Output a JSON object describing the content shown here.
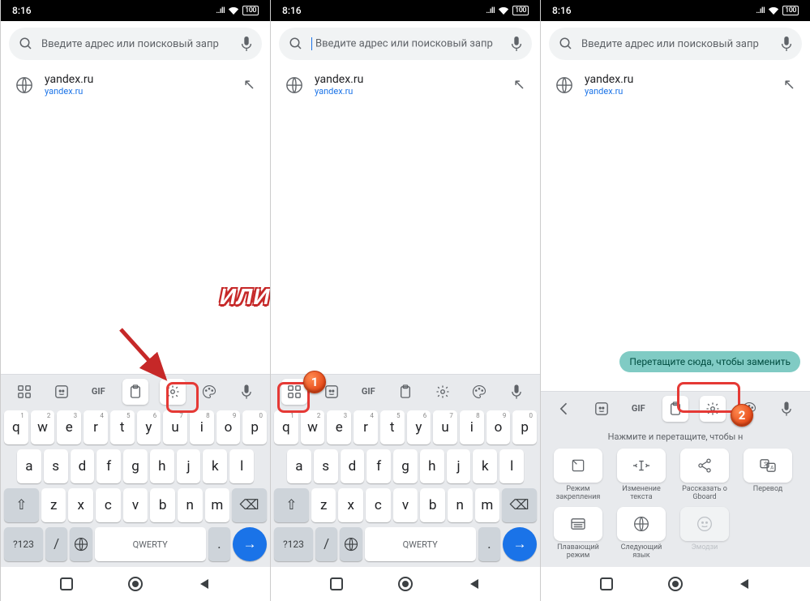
{
  "status": {
    "time": "8:16",
    "signal": "..ıll",
    "wifi": "⊝",
    "battery": "100"
  },
  "search": {
    "placeholder": "Введите адрес или поисковый запр",
    "placeholder_cursor": "Введите адрес или поисковый запр"
  },
  "suggest": {
    "title": "yandex.ru",
    "sub": "yandex.ru"
  },
  "kb": {
    "r1": [
      "q",
      "w",
      "e",
      "r",
      "t",
      "y",
      "u",
      "i",
      "o",
      "p"
    ],
    "n1": [
      "1",
      "2",
      "3",
      "4",
      "5",
      "6",
      "7",
      "8",
      "9",
      "0"
    ],
    "r2": [
      "a",
      "s",
      "d",
      "f",
      "g",
      "h",
      "j",
      "k",
      "l"
    ],
    "r3": [
      "z",
      "x",
      "c",
      "v",
      "b",
      "n",
      "m"
    ],
    "shift": "⇧",
    "back": "⌫",
    "numk": "?123",
    "slash": "/",
    "dot": ".",
    "space": "QWERTY",
    "go": "→"
  },
  "annot": {
    "ili": "ИЛИ",
    "b1": "1",
    "b2": "2"
  },
  "p3": {
    "tooltip": "Перетащите сюда, чтобы заменить",
    "hint": "Нажмите и перетащите, чтобы н",
    "items": [
      {
        "label": "Режим закрепления"
      },
      {
        "label": "Изменение текста"
      },
      {
        "label": "Рассказать о Gboard"
      },
      {
        "label": "Перевод"
      },
      {
        "label": "Плавающий режим"
      },
      {
        "label": "Следующий язык"
      },
      {
        "label": "Эмодзи"
      }
    ]
  }
}
